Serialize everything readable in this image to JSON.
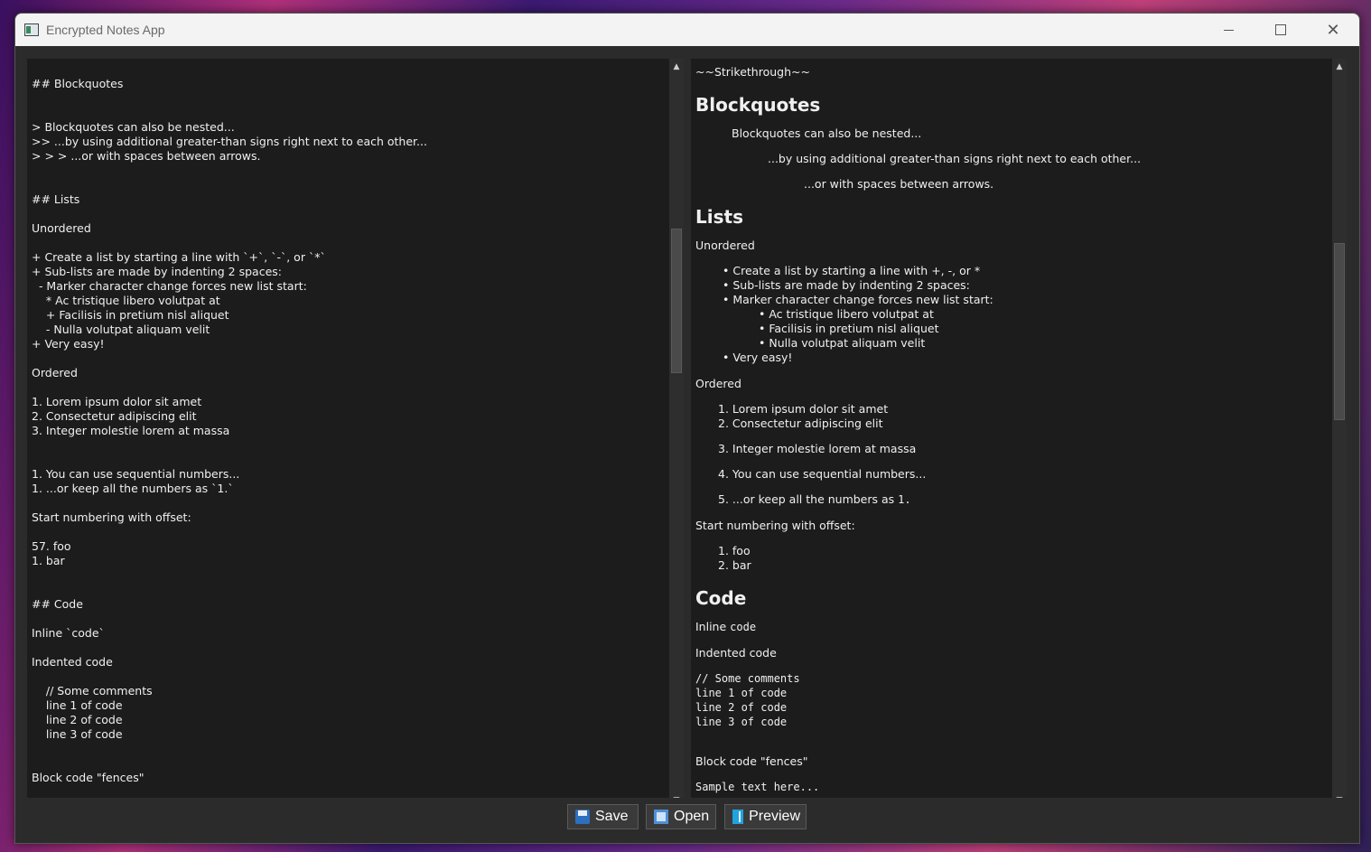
{
  "window": {
    "title": "Encrypted Notes App"
  },
  "editor": {
    "lines": [
      "## Blockquotes",
      "> Blockquotes can also be nested...",
      ">> ...by using additional greater-than signs right next to each other...",
      "> > > ...or with spaces between arrows.",
      "## Lists",
      "Unordered",
      "+ Create a list by starting a line with `+`, `-`, or `*`",
      "+ Sub-lists are made by indenting 2 spaces:",
      "  - Marker character change forces new list start:",
      "    * Ac tristique libero volutpat at",
      "    + Facilisis in pretium nisl aliquet",
      "    - Nulla volutpat aliquam velit",
      "+ Very easy!",
      "Ordered",
      "1. Lorem ipsum dolor sit amet",
      "2. Consectetur adipiscing elit",
      "3. Integer molestie lorem at massa",
      "1. You can use sequential numbers...",
      "1. ...or keep all the numbers as `1.`",
      "Start numbering with offset:",
      "57. foo",
      "1. bar",
      "## Code",
      "Inline `code`",
      "Indented code",
      "    // Some comments",
      "    line 1 of code",
      "    line 2 of code",
      "    line 3 of code",
      "Block code \"fences\""
    ]
  },
  "preview": {
    "strike": "~~Strikethrough~~",
    "h_blockquotes": "Blockquotes",
    "bq1": "Blockquotes can also be nested...",
    "bq2": "...by using additional greater-than signs right next to each other...",
    "bq3": "...or with spaces between arrows.",
    "h_lists": "Lists",
    "unordered": "Unordered",
    "ul1": "• Create a list by starting a line with +, -, or *",
    "ul2": "• Sub-lists are made by indenting 2 spaces:",
    "ul3": "• Marker character change forces new list start:",
    "ul4": "• Ac tristique libero volutpat at",
    "ul5": "• Facilisis in pretium nisl aliquet",
    "ul6": "• Nulla volutpat aliquam velit",
    "ul7": "• Very easy!",
    "ordered": "Ordered",
    "ol1": "1. Lorem ipsum dolor sit amet",
    "ol2": "2. Consectetur adipiscing elit",
    "ol3": "3. Integer molestie lorem at massa",
    "ol4": "4. You can use sequential numbers...",
    "ol5_text": "5. ...or keep all the numbers as ",
    "ol5_code": "1.",
    "offset": "Start numbering with offset:",
    "of1": "1. foo",
    "of2": "2. bar",
    "h_code": "Code",
    "inline_text": "Inline ",
    "inline_code": "code",
    "indented": "Indented code",
    "code1": "// Some comments",
    "code2": "line 1 of code",
    "code3": "line 2 of code",
    "code4": "line 3 of code",
    "fences": "Block code \"fences\"",
    "sample": "Sample text here..."
  },
  "toolbar": {
    "save_label": "Save",
    "open_label": "Open",
    "preview_label": "Preview"
  }
}
